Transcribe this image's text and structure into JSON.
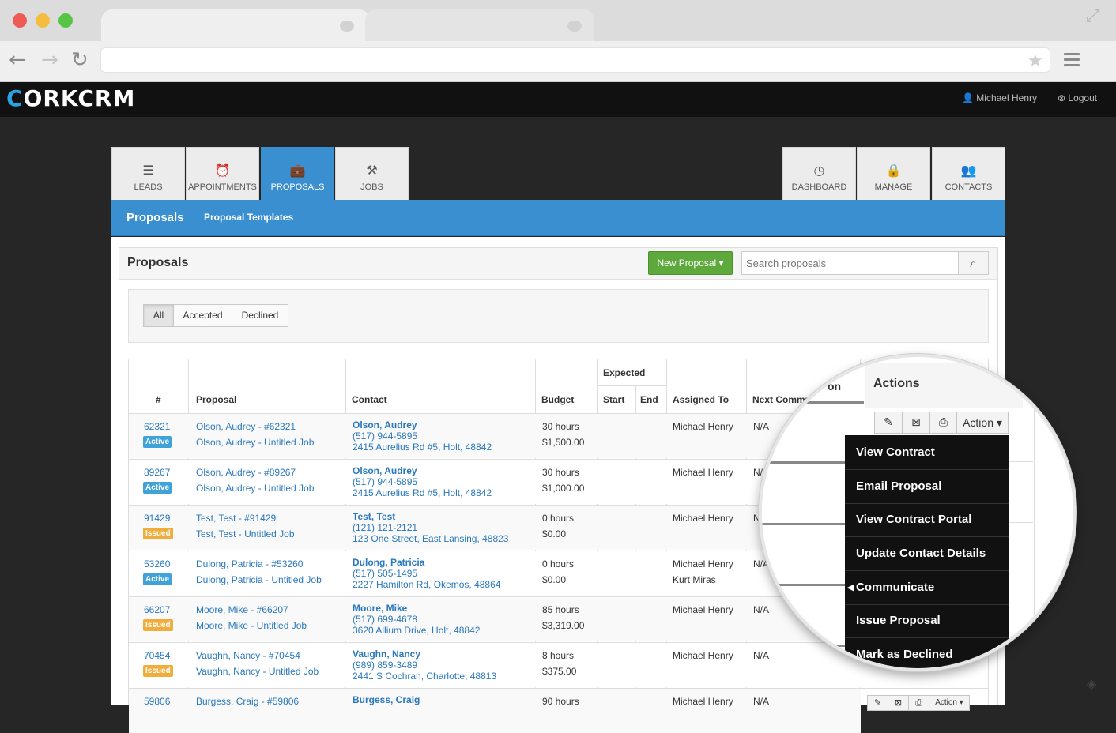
{
  "brand": {
    "logo_c": "C",
    "logo_rest": "ORKCRM"
  },
  "header": {
    "user": "Michael Henry",
    "logout": "Logout"
  },
  "tabs": [
    {
      "label": "LEADS",
      "icon": "menu-icon"
    },
    {
      "label": "APPOINTMENTS",
      "icon": "alarm-clock-icon"
    },
    {
      "label": "PROPOSALS",
      "icon": "briefcase-icon"
    },
    {
      "label": "JOBS",
      "icon": "paint-roller-icon"
    },
    {
      "label": "DASHBOARD",
      "icon": "dashboard-gauge-icon"
    },
    {
      "label": "MANAGE",
      "icon": "lock-icon"
    },
    {
      "label": "CONTACTS",
      "icon": "users-icon"
    }
  ],
  "subnav": {
    "current": "Proposals",
    "templates": "Proposal Templates"
  },
  "card": {
    "title": "Proposals",
    "new_button": "New Proposal",
    "search_placeholder": "Search proposals"
  },
  "filters": [
    "All",
    "Accepted",
    "Declined"
  ],
  "table": {
    "headers": {
      "num": "#",
      "proposal": "Proposal",
      "contact": "Contact",
      "budget": "Budget",
      "expected": "Expected",
      "start": "Start",
      "end": "End",
      "assigned": "Assigned To",
      "next": "Next Commu",
      "next_mag": "on",
      "actions": "Actions"
    },
    "rows": [
      {
        "num": "62321",
        "status": "Active",
        "p1": "Olson, Audrey - #62321",
        "p2": "Olson, Audrey - Untitled Job",
        "cname": "Olson, Audrey",
        "phone": "(517) 944-5895",
        "addr": "2415 Aurelius Rd #5, Holt, 48842",
        "hours": "30 hours",
        "amount": "$1,500.00",
        "assigned": "Michael Henry",
        "assigned2": "",
        "next": "N/A"
      },
      {
        "num": "89267",
        "status": "Active",
        "p1": "Olson, Audrey - #89267",
        "p2": "Olson, Audrey - Untitled Job",
        "cname": "Olson, Audrey",
        "phone": "(517) 944-5895",
        "addr": "2415 Aurelius Rd #5, Holt, 48842",
        "hours": "30 hours",
        "amount": "$1,000.00",
        "assigned": "Michael Henry",
        "assigned2": "",
        "next": "N/A"
      },
      {
        "num": "91429",
        "status": "Issued",
        "p1": "Test, Test - #91429",
        "p2": "Test, Test - Untitled Job",
        "cname": "Test, Test",
        "phone": "(121) 121-2121",
        "addr": "123 One Street, East Lansing, 48823",
        "hours": "0 hours",
        "amount": "$0.00",
        "assigned": "Michael Henry",
        "assigned2": "",
        "next": "N/A"
      },
      {
        "num": "53260",
        "status": "Active",
        "p1": "Dulong, Patricia - #53260",
        "p2": "Dulong, Patricia - Untitled Job",
        "cname": "Dulong, Patricia",
        "phone": "(517) 505-1495",
        "addr": "2227 Hamilton Rd, Okemos, 48864",
        "hours": "0 hours",
        "amount": "$0.00",
        "assigned": "Michael Henry",
        "assigned2": "Kurt Miras",
        "next": "N/A"
      },
      {
        "num": "66207",
        "status": "Issued",
        "p1": "Moore, Mike - #66207",
        "p2": "Moore, Mike - Untitled Job",
        "cname": "Moore, Mike",
        "phone": "(517) 699-4678",
        "addr": "3620 Allium Drive, Holt, 48842",
        "hours": "85 hours",
        "amount": "$3,319.00",
        "assigned": "Michael Henry",
        "assigned2": "",
        "next": "N/A"
      },
      {
        "num": "70454",
        "status": "Issued",
        "p1": "Vaughn, Nancy - #70454",
        "p2": "Vaughn, Nancy - Untitled Job",
        "cname": "Vaughn, Nancy",
        "phone": "(989) 859-3489",
        "addr": "2441 S Cochran, Charlotte, 48813",
        "hours": "8 hours",
        "amount": "$375.00",
        "assigned": "Michael Henry",
        "assigned2": "",
        "next": "N/A"
      },
      {
        "num": "59806",
        "status": "",
        "p1": "Burgess, Craig - #59806",
        "p2": "",
        "cname": "Burgess, Craig",
        "phone": "",
        "addr": "",
        "hours": "90 hours",
        "amount": "",
        "assigned": "Michael Henry",
        "assigned2": "",
        "next": "N/A"
      }
    ]
  },
  "action_button": "Action",
  "action_menu": [
    "View Contract",
    "Email Proposal",
    "View Contract Portal",
    "Update Contact Details",
    "Communicate",
    "Issue Proposal",
    "Mark as Declined"
  ],
  "colors": {
    "accent": "#3a8fd0",
    "new_button": "#5ea93c",
    "active_badge": "#3fa2d8",
    "issued_badge": "#f0ad3a",
    "link": "#2a78bd"
  }
}
